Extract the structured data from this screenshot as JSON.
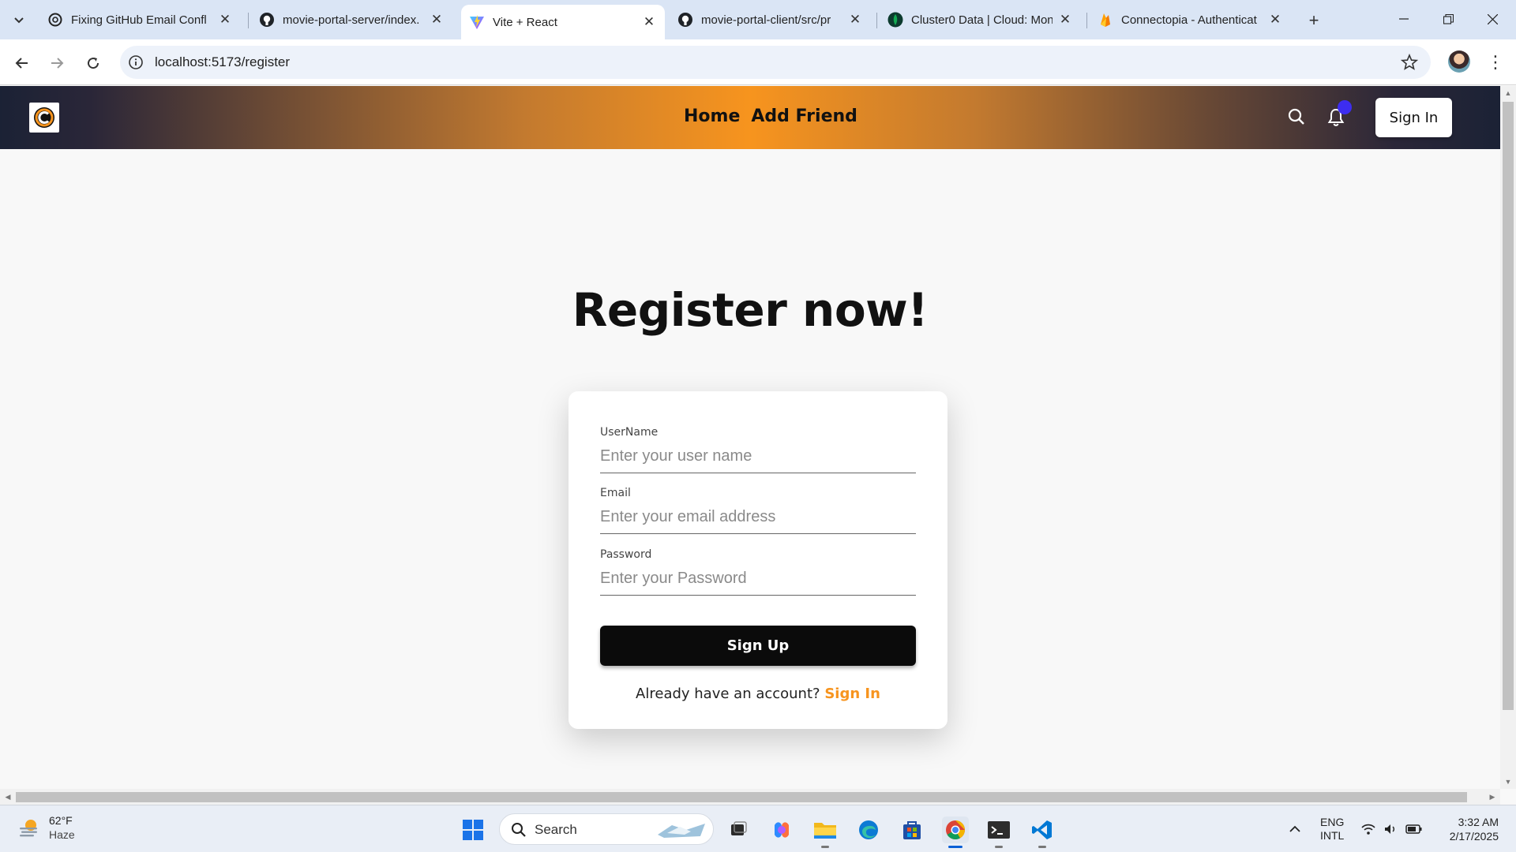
{
  "browser": {
    "tabs": [
      {
        "title": "Fixing GitHub Email Confl",
        "icon": "chatgpt-icon"
      },
      {
        "title": "movie-portal-server/index.",
        "icon": "github-icon"
      },
      {
        "title": "Vite + React",
        "icon": "vite-icon",
        "active": true
      },
      {
        "title": "movie-portal-client/src/pr",
        "icon": "github-icon"
      },
      {
        "title": "Cluster0 Data | Cloud: Mon",
        "icon": "mongodb-icon"
      },
      {
        "title": "Connectopia - Authenticat",
        "icon": "firebase-icon"
      }
    ],
    "url": "localhost:5173/register"
  },
  "site": {
    "nav": {
      "links": [
        "Home",
        "Add Friend"
      ],
      "signin_label": "Sign In"
    },
    "colors": {
      "accent": "#f7941e",
      "nav_dark": "#1b2235",
      "badge": "#3d2df0"
    }
  },
  "register": {
    "title": "Register now!",
    "fields": {
      "username": {
        "label": "UserName",
        "placeholder": "Enter your user name"
      },
      "email": {
        "label": "Email",
        "placeholder": "Enter your email address"
      },
      "password": {
        "label": "Password",
        "placeholder": "Enter your Password"
      }
    },
    "submit_label": "Sign Up",
    "have_account_text": "Already have an account?",
    "signin_link": "Sign In"
  },
  "taskbar": {
    "weather": {
      "temp": "62°F",
      "condition": "Haze"
    },
    "search_label": "Search",
    "lang": {
      "line1": "ENG",
      "line2": "INTL"
    },
    "time": "3:32 AM",
    "date": "2/17/2025"
  }
}
